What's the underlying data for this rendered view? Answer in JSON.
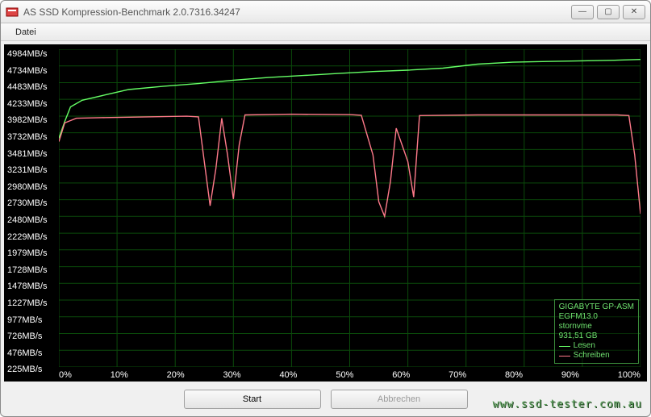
{
  "window": {
    "title": "AS SSD Kompression-Benchmark 2.0.7316.34247",
    "min_icon": "—",
    "max_icon": "▢",
    "close_icon": "✕"
  },
  "menubar": {
    "file": "Datei"
  },
  "buttons": {
    "start": "Start",
    "cancel": "Abbrechen"
  },
  "watermark": "www.ssd-tester.com.au",
  "legend": {
    "device_line1": "GIGABYTE GP-ASM",
    "device_line2": "EGFM13.0",
    "device_line3": "stornvme",
    "device_line4": "931,51 GB",
    "read": "Lesen",
    "write": "Schreiben",
    "read_color": "#66ff66",
    "write_color": "#ff7a8a"
  },
  "chart_data": {
    "type": "line",
    "xlabel": "",
    "ylabel": "",
    "xlim": [
      0,
      100
    ],
    "ylim": [
      225,
      4984
    ],
    "x_ticks": [
      "0%",
      "10%",
      "20%",
      "30%",
      "40%",
      "50%",
      "60%",
      "70%",
      "80%",
      "90%",
      "100%"
    ],
    "y_ticks": [
      "4984MB/s",
      "4734MB/s",
      "4483MB/s",
      "4233MB/s",
      "3982MB/s",
      "3732MB/s",
      "3481MB/s",
      "3231MB/s",
      "2980MB/s",
      "2730MB/s",
      "2480MB/s",
      "2229MB/s",
      "1979MB/s",
      "1728MB/s",
      "1478MB/s",
      "1227MB/s",
      "977MB/s",
      "726MB/s",
      "476MB/s",
      "225MB/s"
    ],
    "series": [
      {
        "name": "Lesen",
        "color": "#66ff66",
        "x": [
          0,
          1,
          2,
          4,
          8,
          12,
          18,
          24,
          30,
          36,
          42,
          48,
          54,
          60,
          66,
          72,
          78,
          84,
          90,
          96,
          100
        ],
        "values": [
          3650,
          3900,
          4120,
          4220,
          4300,
          4380,
          4430,
          4470,
          4520,
          4560,
          4590,
          4620,
          4650,
          4670,
          4700,
          4760,
          4790,
          4800,
          4810,
          4820,
          4830
        ]
      },
      {
        "name": "Schreiben",
        "color": "#ff7a8a",
        "x": [
          0,
          1,
          3,
          8,
          15,
          22,
          24,
          25,
          26,
          27,
          28,
          29,
          30,
          31,
          32,
          40,
          50,
          52,
          54,
          55,
          56,
          57,
          58,
          60,
          61,
          62,
          72,
          82,
          92,
          96,
          98,
          99,
          100
        ],
        "values": [
          3600,
          3880,
          3950,
          3960,
          3970,
          3980,
          3970,
          3300,
          2640,
          3200,
          3950,
          3400,
          2740,
          3550,
          4000,
          4010,
          4005,
          3995,
          3400,
          2700,
          2480,
          3000,
          3800,
          3300,
          2770,
          3990,
          4000,
          4000,
          4000,
          4000,
          3990,
          3400,
          2520
        ]
      }
    ]
  }
}
